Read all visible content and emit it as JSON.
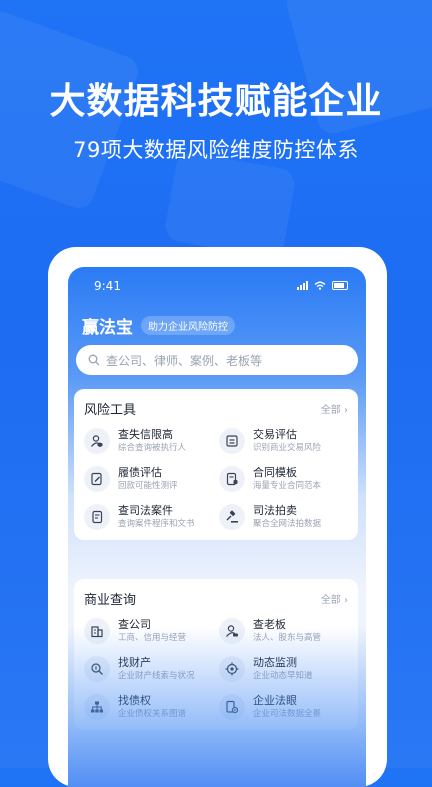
{
  "promo": {
    "headline": "大数据科技赋能企业",
    "subline": "79项大数据风险维度防控体系"
  },
  "status_bar": {
    "time": "9:41"
  },
  "app": {
    "name": "赢法宝",
    "tagline": "助力企业风险防控",
    "search_placeholder": "查公司、律师、案例、老板等"
  },
  "risk_tools": {
    "title": "风险工具",
    "more": "全部",
    "items": [
      {
        "title": "查失信限高",
        "desc": "综合查询被执行人",
        "icon": "person-shield-icon"
      },
      {
        "title": "交易评估",
        "desc": "识别商业交易风险",
        "icon": "card-icon"
      },
      {
        "title": "履债评估",
        "desc": "回款可能性测评",
        "icon": "edit-doc-icon"
      },
      {
        "title": "合同模板",
        "desc": "海量专业合同范本",
        "icon": "contract-icon"
      },
      {
        "title": "查司法案件",
        "desc": "查询案件程序和文书",
        "icon": "case-doc-icon"
      },
      {
        "title": "司法拍卖",
        "desc": "聚合全网法拍数据",
        "icon": "gavel-icon"
      }
    ]
  },
  "business_query": {
    "title": "商业查询",
    "more": "全部",
    "items": [
      {
        "title": "查公司",
        "desc": "工商、信用与经营",
        "icon": "building-icon"
      },
      {
        "title": "查老板",
        "desc": "法人、股东与高管",
        "icon": "ceo-icon"
      },
      {
        "title": "找财产",
        "desc": "企业财产线索与状况",
        "icon": "money-search-icon"
      },
      {
        "title": "动态监测",
        "desc": "企业动态早知道",
        "icon": "target-icon"
      },
      {
        "title": "找债权",
        "desc": "企业债权关系图谱",
        "icon": "org-chart-icon"
      },
      {
        "title": "企业法眼",
        "desc": "企业司法数据全景",
        "icon": "eye-doc-icon"
      }
    ]
  },
  "colors": {
    "brand_blue": "#1f73f5",
    "card_bg": "#ffffff",
    "icon_bg": "#eef2f8"
  }
}
